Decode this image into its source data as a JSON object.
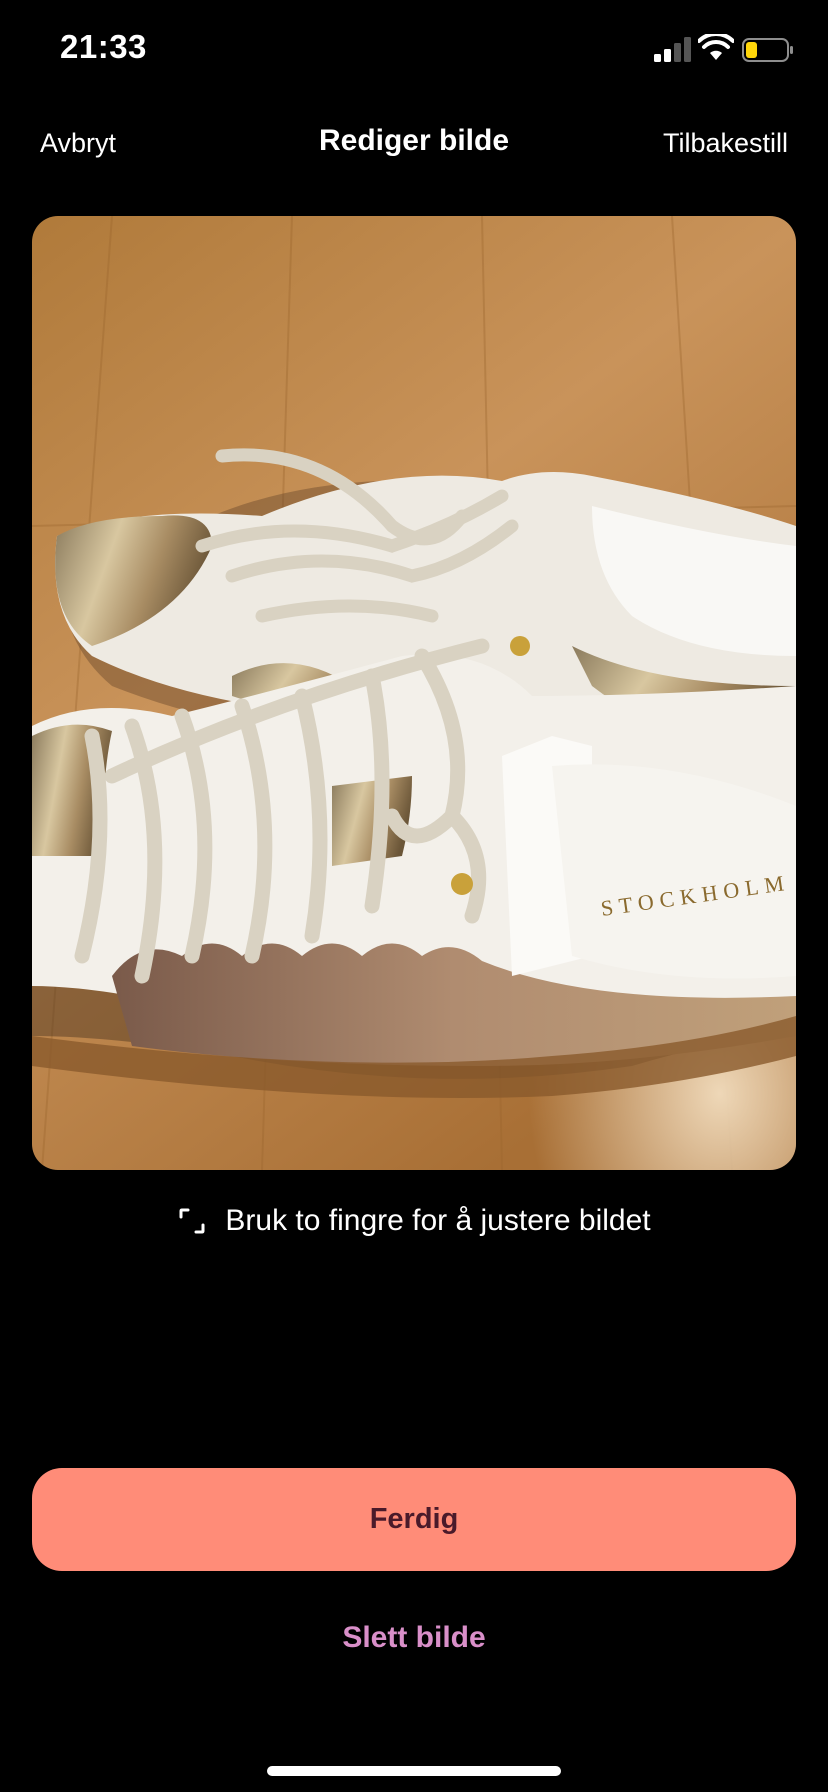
{
  "status_bar": {
    "time": "21:33",
    "battery_color": "#FFD60A"
  },
  "nav": {
    "cancel_label": "Avbryt",
    "title": "Rediger bilde",
    "reset_label": "Tilbakestill"
  },
  "photo": {
    "alt": "Hvite og gullfargede sneakers på tregulv",
    "brand_text": "STOCKHOLM DESIGN GROUP"
  },
  "hint": {
    "icon": "crop-icon",
    "text": "Bruk to fingre for å justere bildet"
  },
  "actions": {
    "done_label": "Ferdig",
    "done_color": "#FF8C78",
    "delete_label": "Slett bilde",
    "delete_color": "#D98FC9"
  }
}
